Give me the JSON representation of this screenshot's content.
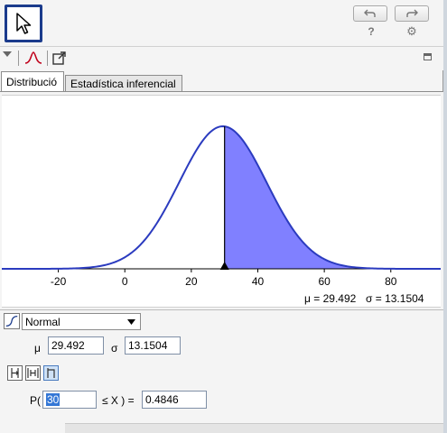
{
  "tabs": [
    {
      "label": "Distribució",
      "active": true
    },
    {
      "label": "Estadística inferencial",
      "active": false
    }
  ],
  "toolbar": {
    "icons": [
      "move-tool-icon",
      "undo-icon",
      "redo-icon",
      "help-icon",
      "settings-icon"
    ],
    "help_glyph": "?",
    "settings_glyph": "⚙"
  },
  "stylebar": {
    "icons": [
      "menu-triangle-icon",
      "distribution-curve-icon",
      "export-icon",
      "dock-icon"
    ]
  },
  "chart_data": {
    "type": "area",
    "distribution": "normal",
    "mu": 29.492,
    "sigma": 13.1504,
    "shaded_from": 30,
    "shaded_to": "infinity",
    "x_ticks": [
      -20,
      0,
      20,
      40,
      60,
      80
    ],
    "xlim": [
      -37,
      95
    ],
    "marker_x": 30,
    "colors": {
      "curve": "#2b3bbf",
      "fill": "#8080ff"
    }
  },
  "stats": {
    "mu_text": "μ = 29.492",
    "sigma_text": "σ = 13.1504"
  },
  "distribution": {
    "selected": "Normal"
  },
  "params": {
    "mu_label": "μ",
    "mu_value": "29.492",
    "sigma_label": "σ",
    "sigma_value": "13.1504"
  },
  "interval_buttons": [
    "left-sided-icon",
    "two-sided-icon",
    "right-sided-icon"
  ],
  "probability": {
    "prefix": "P(",
    "from_value": "30",
    "middle": "≤ X ) =",
    "result": "0.4846"
  }
}
